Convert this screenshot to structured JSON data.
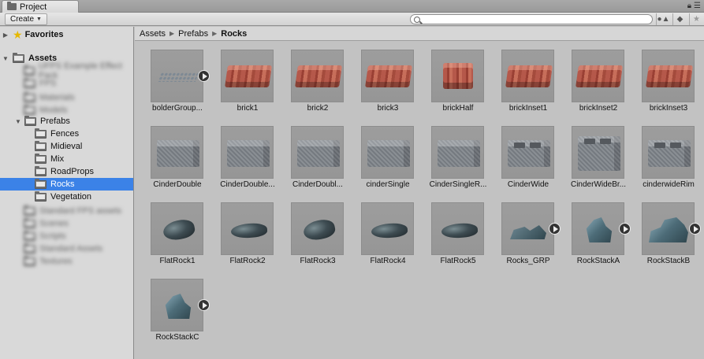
{
  "tab": {
    "title": "Project"
  },
  "toolbar": {
    "create_label": "Create",
    "search_value": "",
    "search_placeholder": ""
  },
  "tree": {
    "favorites_label": "Favorites",
    "assets_label": "Assets",
    "prefabs_label": "Prefabs",
    "prefab_children": [
      "Fences",
      "Midieval",
      "Mix",
      "RoadProps",
      "Rocks",
      "Vegetation"
    ],
    "selected": "Rocks",
    "blurred_items_above": [
      "UFPS Example Effect Pack",
      "FPS",
      "Materials",
      "Models"
    ],
    "blurred_items_below": [
      "Standard FPS assets",
      "Scenes",
      "Scripts",
      "Standard Assets",
      "Textures"
    ]
  },
  "breadcrumb": [
    "Assets",
    "Prefabs",
    "Rocks"
  ],
  "assets": [
    {
      "name": "bolderGroup...",
      "kind": "gravel",
      "play": true
    },
    {
      "name": "brick1",
      "kind": "brick",
      "play": false
    },
    {
      "name": "brick2",
      "kind": "brick",
      "play": false
    },
    {
      "name": "brick3",
      "kind": "brick",
      "play": false
    },
    {
      "name": "brickHalf",
      "kind": "brick-half",
      "play": false
    },
    {
      "name": "brickInset1",
      "kind": "brick",
      "play": false
    },
    {
      "name": "brickInset2",
      "kind": "brick",
      "play": false
    },
    {
      "name": "brickInset3",
      "kind": "brick",
      "play": false
    },
    {
      "name": "CinderDouble",
      "kind": "cinder",
      "play": false
    },
    {
      "name": "CinderDouble...",
      "kind": "cinder",
      "play": false
    },
    {
      "name": "CinderDoubl...",
      "kind": "cinder",
      "play": false
    },
    {
      "name": "cinderSingle",
      "kind": "cinder",
      "play": false
    },
    {
      "name": "CinderSingleR...",
      "kind": "cinder",
      "play": false
    },
    {
      "name": "CinderWide",
      "kind": "cinder-holes",
      "play": false
    },
    {
      "name": "CinderWideBr...",
      "kind": "cinder-tall",
      "play": false
    },
    {
      "name": "cinderwideRim",
      "kind": "cinder-holes",
      "play": false
    },
    {
      "name": "FlatRock1",
      "kind": "rock",
      "play": false
    },
    {
      "name": "FlatRock2",
      "kind": "rock-flat",
      "play": false
    },
    {
      "name": "FlatRock3",
      "kind": "rock",
      "play": false
    },
    {
      "name": "FlatRock4",
      "kind": "rock-flat",
      "play": false
    },
    {
      "name": "FlatRock5",
      "kind": "rock-flat",
      "play": false
    },
    {
      "name": "Rocks_GRP",
      "kind": "stack-grp",
      "play": true
    },
    {
      "name": "RockStackA",
      "kind": "stack",
      "play": true
    },
    {
      "name": "RockStackB",
      "kind": "stack-b",
      "play": true
    },
    {
      "name": "RockStackC",
      "kind": "stack",
      "play": true
    }
  ]
}
